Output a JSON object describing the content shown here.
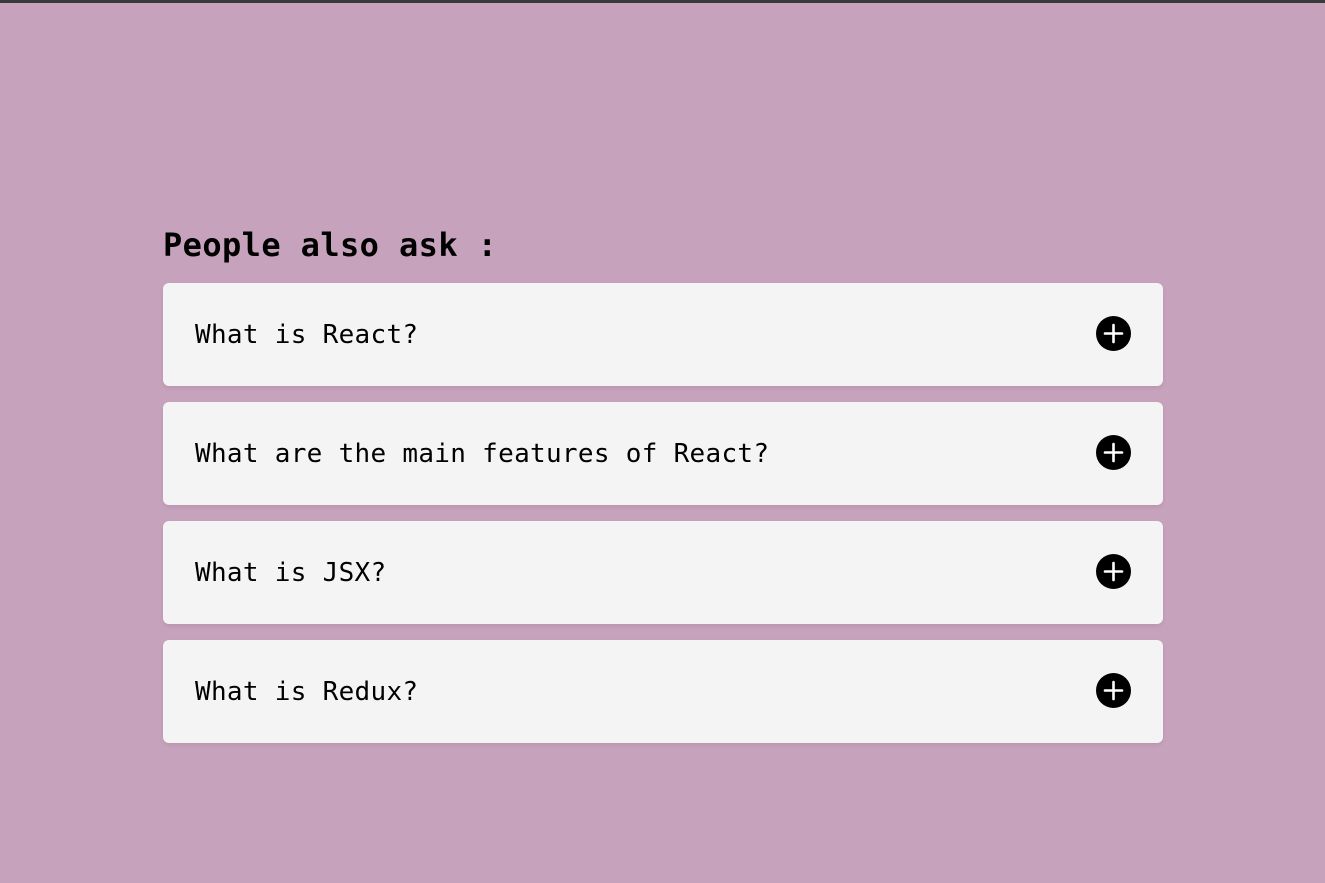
{
  "section": {
    "heading": "People also ask :"
  },
  "faq": {
    "items": [
      {
        "question": "What is React?",
        "icon": "plus-circle-icon",
        "expanded": false
      },
      {
        "question": "What are the main features of React?",
        "icon": "plus-circle-icon",
        "expanded": false
      },
      {
        "question": "What is JSX?",
        "icon": "plus-circle-icon",
        "expanded": false
      },
      {
        "question": "What is Redux?",
        "icon": "plus-circle-icon",
        "expanded": false
      }
    ]
  },
  "colors": {
    "page_background": "#c7a2bc",
    "card_background": "#f4f4f4",
    "text": "#000000",
    "icon": "#000000",
    "top_border": "#3a3a3a"
  }
}
